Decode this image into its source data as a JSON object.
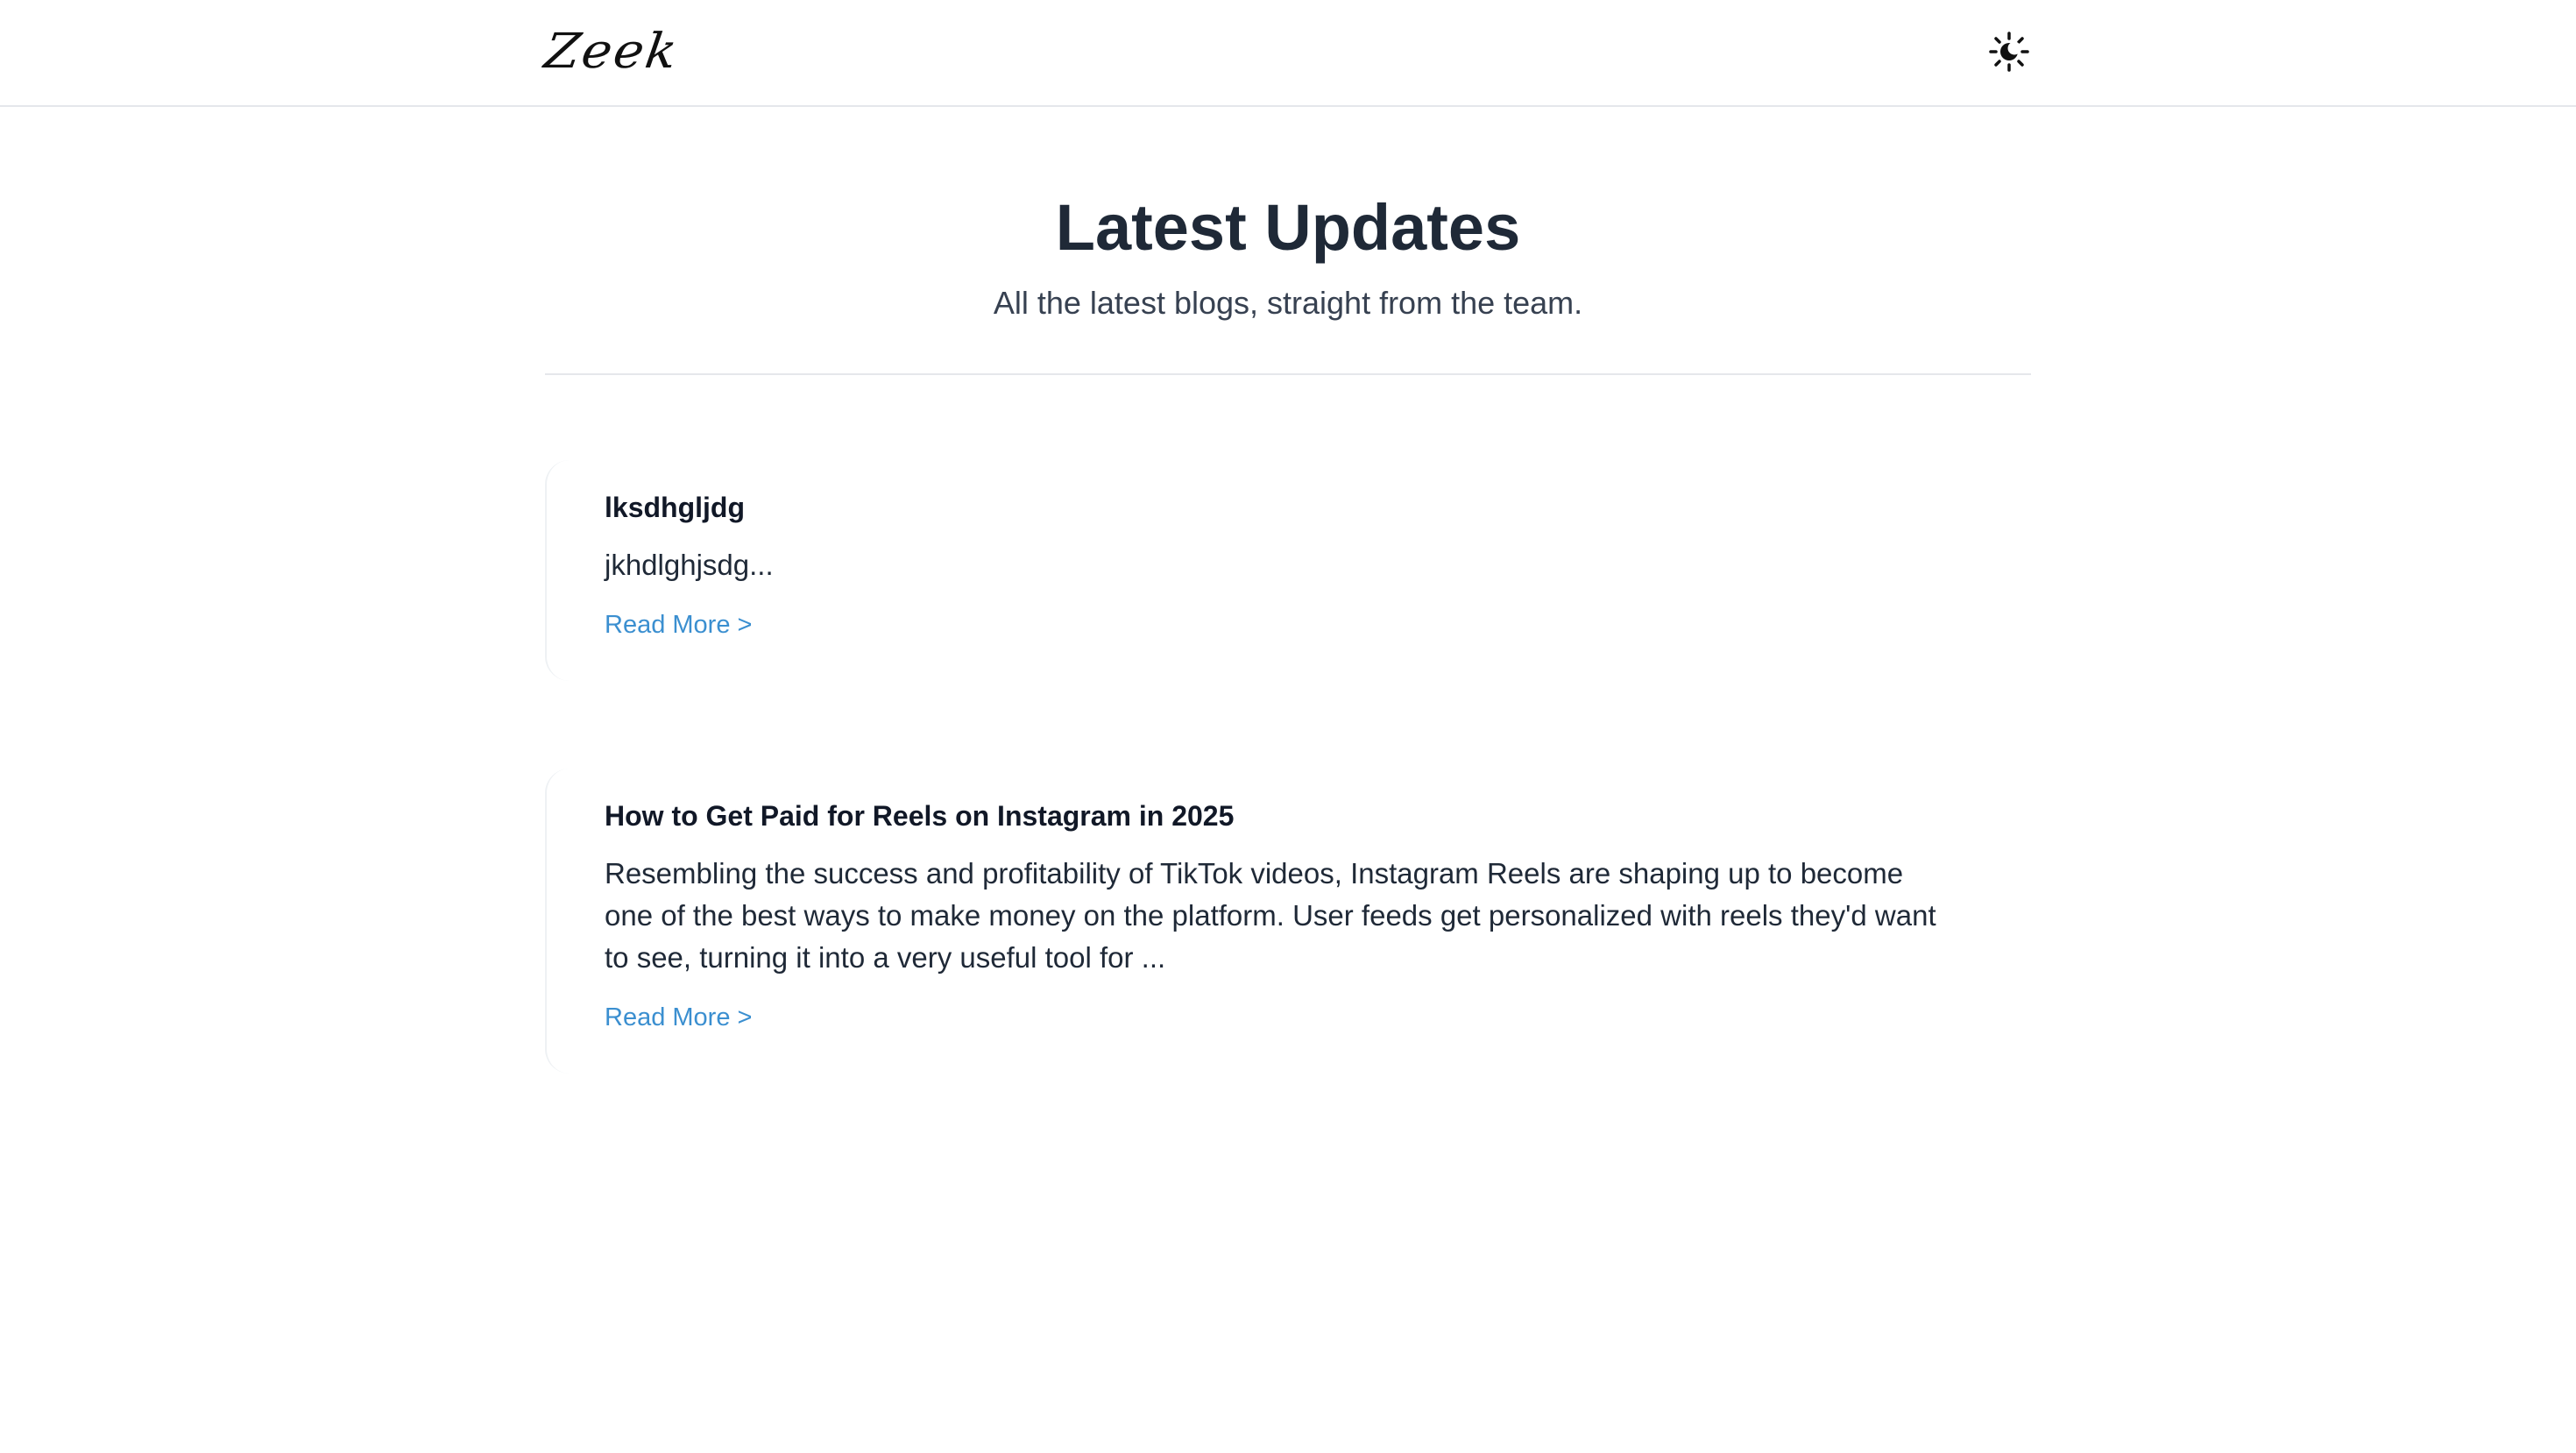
{
  "header": {
    "logo_text": "Zeek",
    "theme_toggle_icon": "sun-moon-icon"
  },
  "hero": {
    "title": "Latest Updates",
    "subtitle": "All the latest blogs, straight from the team."
  },
  "posts": [
    {
      "title": "lksdhgljdg",
      "excerpt": "jkhdlghjsdg...",
      "link_label": "Read More >"
    },
    {
      "title": "How to Get Paid for Reels on Instagram in 2025",
      "excerpt": "Resembling the success and profitability of TikTok videos, Instagram Reels are shaping up to become one of the best ways to make money on the platform. User feeds get personalized with reels they'd want to see, turning it into a very useful tool for ...",
      "link_label": "Read More >"
    }
  ],
  "colors": {
    "link": "#3b8fd0",
    "heading": "#1f2937",
    "divider": "#e5e7eb"
  }
}
